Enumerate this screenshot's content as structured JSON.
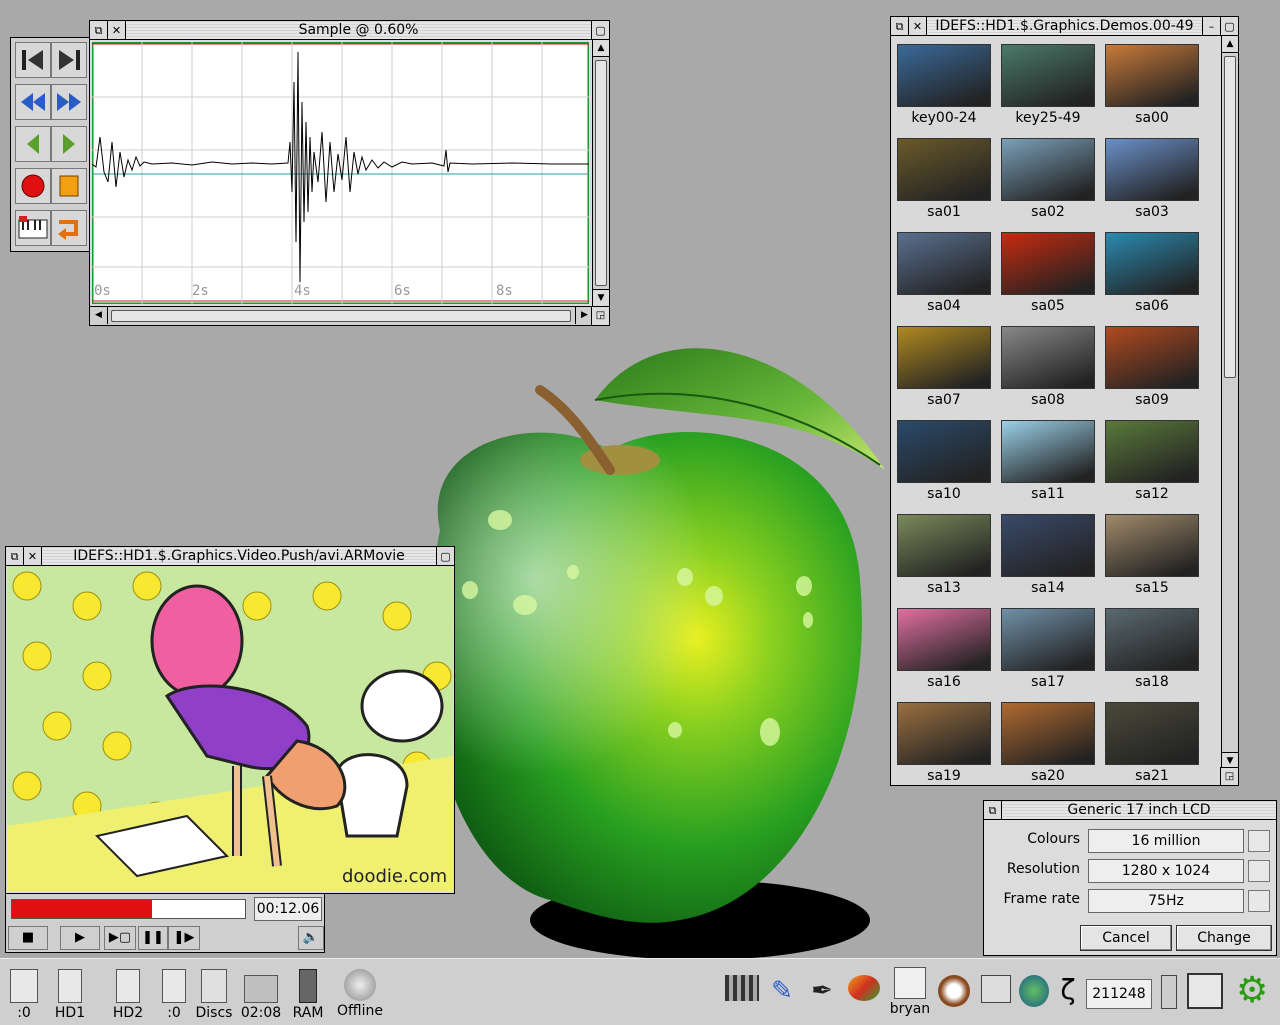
{
  "audio_window": {
    "title": "Sample @ 0.60%",
    "time_labels": [
      "0s",
      "2s",
      "4s",
      "6s",
      "8s"
    ]
  },
  "audio_toolbar": {
    "icons": [
      "skip-start-icon",
      "skip-end-icon",
      "rewind-icon",
      "fast-forward-icon",
      "step-back-icon",
      "step-forward-icon",
      "record-icon",
      "stop-icon",
      "keyboard-icon",
      "loop-icon"
    ]
  },
  "filer": {
    "title": "IDEFS::HD1.$.Graphics.Demos.00-49",
    "items": [
      {
        "label": "key00-24",
        "color": "#3a6a9a"
      },
      {
        "label": "key25-49",
        "color": "#4a7a6a"
      },
      {
        "label": "sa00",
        "color": "#c87a3a"
      },
      {
        "label": "sa01",
        "color": "#6a5a2a"
      },
      {
        "label": "sa02",
        "color": "#7aa0b8"
      },
      {
        "label": "sa03",
        "color": "#6a90c8"
      },
      {
        "label": "sa04",
        "color": "#5a7090"
      },
      {
        "label": "sa05",
        "color": "#c82a10"
      },
      {
        "label": "sa06",
        "color": "#2a8ab0"
      },
      {
        "label": "sa07",
        "color": "#b08a20"
      },
      {
        "label": "sa08",
        "color": "#888888"
      },
      {
        "label": "sa09",
        "color": "#b04a20"
      },
      {
        "label": "sa10",
        "color": "#2a4a6a"
      },
      {
        "label": "sa11",
        "color": "#9ad0e8"
      },
      {
        "label": "sa12",
        "color": "#5a7a3a"
      },
      {
        "label": "sa13",
        "color": "#7a8a5a"
      },
      {
        "label": "sa14",
        "color": "#3a4a6a"
      },
      {
        "label": "sa15",
        "color": "#a08a6a"
      },
      {
        "label": "sa16",
        "color": "#e070a0"
      },
      {
        "label": "sa17",
        "color": "#7090a8"
      },
      {
        "label": "sa18",
        "color": "#5a6a70"
      },
      {
        "label": "sa19",
        "color": "#9a7040"
      },
      {
        "label": "sa20",
        "color": "#b06a30"
      },
      {
        "label": "sa21",
        "color": "#4a4a3a"
      }
    ]
  },
  "movie_window": {
    "title": "IDEFS::HD1.$.Graphics.Video.Push/avi.ARMovie",
    "watermark": "doodie.com",
    "time": "00:12.06",
    "progress": 0.6
  },
  "display_dialog": {
    "title": "Generic 17 inch LCD",
    "rows": [
      {
        "label": "Colours",
        "value": "16 million"
      },
      {
        "label": "Resolution",
        "value": "1280 x 1024"
      },
      {
        "label": "Frame rate",
        "value": "75Hz"
      }
    ],
    "cancel_label": "Cancel",
    "change_label": "Change"
  },
  "iconbar": {
    "left": [
      {
        "label": ":0",
        "icon": "floppy-drive-icon"
      },
      {
        "label": "HD1",
        "icon": "hard-disc-icon"
      },
      {
        "label": "HD2",
        "icon": "hard-disc-icon"
      },
      {
        "label": ":0",
        "icon": "cd-drive-icon"
      },
      {
        "label": "Discs",
        "icon": "discs-icon"
      },
      {
        "label": "02:08",
        "icon": "clock-app-icon"
      },
      {
        "label": "RAM",
        "icon": "ram-disc-icon"
      },
      {
        "label": "Offline",
        "icon": "network-icon"
      }
    ],
    "right": [
      {
        "label": "",
        "icon": "film-icon"
      },
      {
        "label": "",
        "icon": "draw-icon"
      },
      {
        "label": "",
        "icon": "edit-icon"
      },
      {
        "label": "",
        "icon": "paint-icon"
      },
      {
        "label": "bryan",
        "icon": "news-icon"
      },
      {
        "label": "",
        "icon": "dog-icon"
      },
      {
        "label": "",
        "icon": "printer-icon"
      },
      {
        "label": "",
        "icon": "globe-icon"
      },
      {
        "label": "",
        "icon": "leaf-icon"
      },
      {
        "label": "",
        "icon": "zeta-icon"
      }
    ],
    "free_memory": "211248",
    "icons_right": [
      "display-icon",
      "task-manager-icon",
      "gear-icon"
    ]
  }
}
